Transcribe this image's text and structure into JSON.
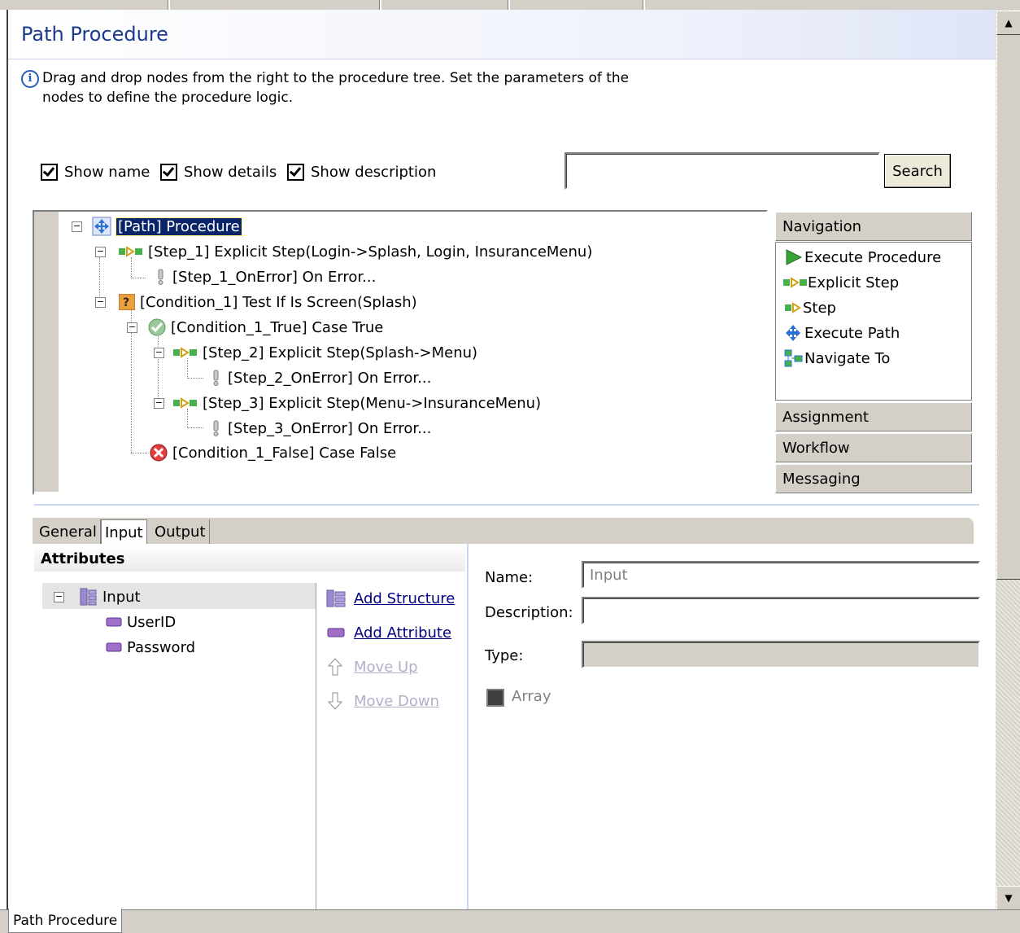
{
  "header": {
    "title": "Path Procedure",
    "info": "Drag and drop nodes from the right to the procedure tree. Set the parameters of the nodes to define the procedure logic."
  },
  "options": {
    "show_name": "Show name",
    "show_details": "Show details",
    "show_description": "Show description",
    "search_value": "",
    "search_button": "Search"
  },
  "tree": {
    "root": "[Path] Procedure",
    "step1": "[Step_1] Explicit Step(Login->Splash, Login, InsuranceMenu)",
    "step1_err": "[Step_1_OnError] On Error...",
    "cond1": "[Condition_1] Test If Is Screen(Splash)",
    "cond1_true": "[Condition_1_True] Case True",
    "step2": "[Step_2] Explicit Step(Splash->Menu)",
    "step2_err": "[Step_2_OnError] On Error...",
    "step3": "[Step_3] Explicit Step(Menu->InsuranceMenu)",
    "step3_err": "[Step_3_OnError] On Error...",
    "cond1_false": "[Condition_1_False] Case False"
  },
  "palette": {
    "navigation": "Navigation",
    "items": [
      "Execute Procedure",
      "Explicit Step",
      "Step",
      "Execute Path",
      "Navigate To"
    ],
    "assignment": "Assignment",
    "workflow": "Workflow",
    "messaging": "Messaging"
  },
  "tabs": [
    "General",
    "Input",
    "Output"
  ],
  "attributes": {
    "heading": "Attributes",
    "root": "Input",
    "children": [
      "UserID",
      "Password"
    ],
    "add_structure": "Add Structure",
    "add_attribute": "Add Attribute",
    "move_up": "Move Up",
    "move_down": "Move Down"
  },
  "details": {
    "name_label": "Name:",
    "name_value": "Input",
    "description_label": "Description:",
    "description_value": "",
    "type_label": "Type:",
    "type_value": "",
    "array_label": "Array"
  },
  "footer": {
    "tab": "Path Procedure"
  },
  "colors": {
    "title": "#1c3a8c",
    "selection": "#0a246a",
    "link": "#000080"
  }
}
